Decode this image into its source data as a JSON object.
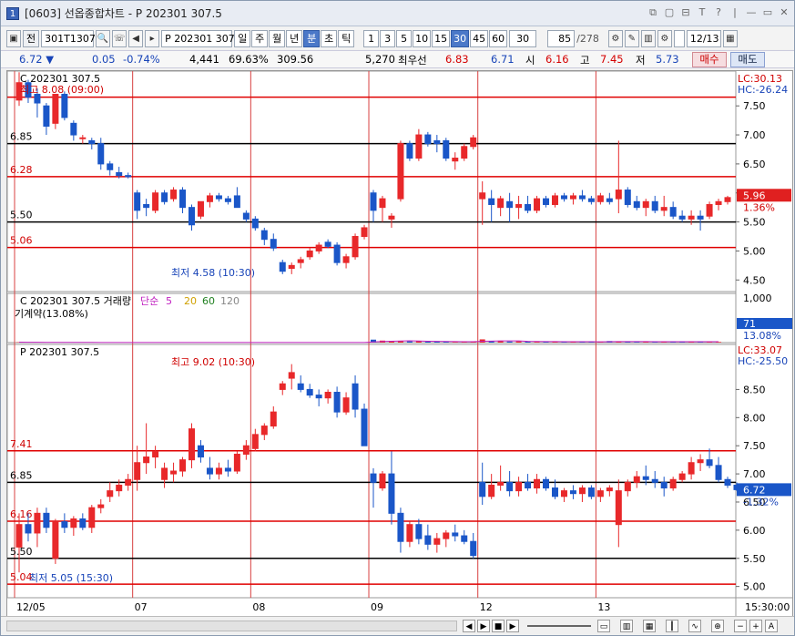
{
  "window": {
    "title": "[0603] 선옵종합차트 - P 202301 307.5",
    "icon_text": "1",
    "title_buttons": [
      "⧉",
      "▢",
      "⊟",
      "T",
      "?",
      "|",
      "—",
      "▭",
      "✕"
    ]
  },
  "toolbar": {
    "code1": "301T1307",
    "label_jeon": "전",
    "code2": "P 202301 307",
    "periods": [
      "일",
      "주",
      "월",
      "년",
      "분",
      "초",
      "틱"
    ],
    "selected_period": "분",
    "intervals": [
      "1",
      "3",
      "5",
      "10",
      "15",
      "30",
      "45",
      "60"
    ],
    "selected_interval": "30",
    "interval_select": "30",
    "count": "85",
    "count_total": "/278",
    "date": "12/13"
  },
  "infobar": {
    "price": "6.72",
    "change_arrow": "▼",
    "change": "0.05",
    "change_pct": "-0.74%",
    "volume": "4,441",
    "vol_pct": "69.63%",
    "v3": "309.56",
    "v4": "5,270",
    "best_label": "최우선",
    "best_ask": "6.83",
    "best_bid": "6.71",
    "open_label": "시",
    "open": "6.16",
    "high_label": "고",
    "high": "7.45",
    "low_label": "저",
    "low": "5.73",
    "buy": "매수",
    "sell": "매도"
  },
  "panel1": {
    "title": "C 202301 307.5",
    "high_note": "최고 8.08 (09:00)",
    "low_note": "최저 4.58 (10:30)",
    "lc": "LC:30.13",
    "hc": "HC:-26.24",
    "ticks": [
      "7.50",
      "7.00",
      "6.50",
      "6.00",
      "5.50",
      "5.00",
      "4.50"
    ],
    "price_tag": "5.96",
    "price_pct": "1.36%",
    "levels": [
      "6.85",
      "6.28",
      "5.50",
      "5.06"
    ]
  },
  "panel2": {
    "title": "C 202301 307.5 거래량",
    "ma_label": "단순",
    "mas": [
      "5",
      "20",
      "60",
      "120"
    ],
    "oi": "기계약(13.08%)",
    "ticks": [
      "1,000"
    ],
    "tag": "71",
    "tag_pct": "13.08%"
  },
  "panel3": {
    "title": "P 202301 307.5",
    "high_note": "최고 9.02 (10:30)",
    "low_note": "최저 5.05 (15:30)",
    "lc": "LC:33.07",
    "hc": "HC:-25.50",
    "ticks": [
      "8.50",
      "8.00",
      "7.50",
      "7.00",
      "6.50",
      "6.00",
      "5.50",
      "5.00"
    ],
    "price_tag": "6.72",
    "price_pct": "-1.32%",
    "levels": [
      "7.41",
      "6.85",
      "6.16",
      "5.50",
      "5.04"
    ]
  },
  "xaxis": {
    "labels": [
      "12/05",
      "07",
      "08",
      "09",
      "12",
      "13"
    ],
    "time": "15:30:00"
  },
  "colors": {
    "up": "#e8282a",
    "down": "#1a56c8",
    "level_red": "#e00000",
    "level_black": "#000000"
  },
  "chart_data": [
    {
      "type": "candlestick",
      "title": "C 202301 307.5",
      "ylim": [
        4.3,
        8.1
      ],
      "candles": [
        [
          7.6,
          8.08,
          7.5,
          7.9
        ],
        [
          7.9,
          7.95,
          7.55,
          7.65
        ],
        [
          7.7,
          7.8,
          7.3,
          7.55
        ],
        [
          7.5,
          7.55,
          7.0,
          7.15
        ],
        [
          7.2,
          7.7,
          7.1,
          7.7
        ],
        [
          7.7,
          7.75,
          7.25,
          7.3
        ],
        [
          7.2,
          7.25,
          6.9,
          7.0
        ],
        [
          6.95,
          7.0,
          6.85,
          6.95
        ],
        [
          6.9,
          6.95,
          6.75,
          6.85
        ],
        [
          6.85,
          6.95,
          6.4,
          6.5
        ],
        [
          6.5,
          6.55,
          6.3,
          6.4
        ],
        [
          6.35,
          6.45,
          6.25,
          6.3
        ],
        [
          6.3,
          6.35,
          6.25,
          6.28
        ],
        [
          6.0,
          6.05,
          5.55,
          5.7
        ],
        [
          5.8,
          5.9,
          5.6,
          5.75
        ],
        [
          5.7,
          6.05,
          5.65,
          6.0
        ],
        [
          6.0,
          6.05,
          5.8,
          5.85
        ],
        [
          5.9,
          6.1,
          5.85,
          6.05
        ],
        [
          6.05,
          6.1,
          5.65,
          5.75
        ],
        [
          5.75,
          5.8,
          5.35,
          5.45
        ],
        [
          5.6,
          5.85,
          5.55,
          5.85
        ],
        [
          5.85,
          6.0,
          5.75,
          5.95
        ],
        [
          5.95,
          6.0,
          5.85,
          5.9
        ],
        [
          5.9,
          5.95,
          5.8,
          5.85
        ],
        [
          5.95,
          6.1,
          5.8,
          5.75
        ],
        [
          5.65,
          5.7,
          5.5,
          5.55
        ],
        [
          5.55,
          5.6,
          5.35,
          5.4
        ],
        [
          5.35,
          5.4,
          5.1,
          5.2
        ],
        [
          5.2,
          5.3,
          5.0,
          5.05
        ],
        [
          4.8,
          4.85,
          4.6,
          4.65
        ],
        [
          4.7,
          4.8,
          4.6,
          4.75
        ],
        [
          4.8,
          4.9,
          4.7,
          4.85
        ],
        [
          4.9,
          5.05,
          4.85,
          5.0
        ],
        [
          5.0,
          5.15,
          4.95,
          5.1
        ],
        [
          5.15,
          5.2,
          5.05,
          5.08
        ],
        [
          5.1,
          5.15,
          4.75,
          4.8
        ],
        [
          4.8,
          4.95,
          4.7,
          4.9
        ],
        [
          4.9,
          5.3,
          4.85,
          5.25
        ],
        [
          5.25,
          5.45,
          5.2,
          5.4
        ],
        [
          6.0,
          6.05,
          5.5,
          5.7
        ],
        [
          5.75,
          5.95,
          5.5,
          5.9
        ],
        [
          5.55,
          5.65,
          5.4,
          5.6
        ],
        [
          5.9,
          6.9,
          5.85,
          6.85
        ],
        [
          6.85,
          6.9,
          6.55,
          6.6
        ],
        [
          6.6,
          7.1,
          6.55,
          7.0
        ],
        [
          7.0,
          7.05,
          6.8,
          6.85
        ],
        [
          6.9,
          7.0,
          6.7,
          6.85
        ],
        [
          6.9,
          6.95,
          6.55,
          6.6
        ],
        [
          6.55,
          6.7,
          6.4,
          6.6
        ],
        [
          6.6,
          6.85,
          6.55,
          6.8
        ],
        [
          6.8,
          7.0,
          6.75,
          6.95
        ],
        [
          5.9,
          6.2,
          5.45,
          6.0
        ],
        [
          5.9,
          6.05,
          5.5,
          5.8
        ],
        [
          5.75,
          5.95,
          5.6,
          5.9
        ],
        [
          5.85,
          6.0,
          5.5,
          5.75
        ],
        [
          5.75,
          5.95,
          5.55,
          5.8
        ],
        [
          5.8,
          5.95,
          5.65,
          5.7
        ],
        [
          5.7,
          5.95,
          5.65,
          5.9
        ],
        [
          5.9,
          5.95,
          5.75,
          5.8
        ],
        [
          5.8,
          6.0,
          5.75,
          5.95
        ],
        [
          5.95,
          6.0,
          5.85,
          5.9
        ],
        [
          5.9,
          6.0,
          5.8,
          5.95
        ],
        [
          5.95,
          6.05,
          5.85,
          5.9
        ],
        [
          5.9,
          5.95,
          5.8,
          5.85
        ],
        [
          5.85,
          6.0,
          5.8,
          5.95
        ],
        [
          5.9,
          6.0,
          5.8,
          5.85
        ],
        [
          5.9,
          6.9,
          5.65,
          6.05
        ],
        [
          6.05,
          6.1,
          5.75,
          5.8
        ],
        [
          5.85,
          5.95,
          5.7,
          5.75
        ],
        [
          5.75,
          5.9,
          5.6,
          5.85
        ],
        [
          5.85,
          5.95,
          5.65,
          5.7
        ],
        [
          5.7,
          5.95,
          5.6,
          5.75
        ],
        [
          5.75,
          5.85,
          5.55,
          5.6
        ],
        [
          5.6,
          5.7,
          5.5,
          5.55
        ],
        [
          5.55,
          5.7,
          5.45,
          5.6
        ],
        [
          5.6,
          5.7,
          5.35,
          5.55
        ],
        [
          5.6,
          5.85,
          5.55,
          5.8
        ],
        [
          5.8,
          5.9,
          5.7,
          5.85
        ],
        [
          5.85,
          5.95,
          5.8,
          5.92
        ]
      ]
    },
    {
      "type": "bar",
      "title": "C 202301 307.5 거래량",
      "values": [
        10,
        4,
        6,
        3,
        8,
        5,
        3,
        2,
        3,
        4,
        3,
        2,
        2,
        3,
        2,
        3,
        2,
        4,
        3,
        4,
        2,
        3,
        2,
        3,
        2,
        3,
        4,
        3,
        4,
        2,
        3,
        2,
        2,
        3,
        2,
        2,
        4,
        5,
        3,
        66,
        45,
        38,
        32,
        28,
        34,
        22,
        25,
        20,
        15,
        18,
        26,
        72,
        40,
        30,
        25,
        28,
        22,
        18,
        25,
        20,
        22,
        18,
        16,
        20,
        18,
        35,
        25,
        22,
        18,
        20,
        18,
        24,
        20,
        16,
        22,
        18,
        25,
        15
      ],
      "ylim": [
        0,
        1100
      ]
    },
    {
      "type": "candlestick",
      "title": "P 202301 307.5",
      "ylim": [
        4.8,
        9.3
      ],
      "candles": [
        [
          5.7,
          6.3,
          5.25,
          6.1
        ],
        [
          6.1,
          6.3,
          5.8,
          5.95
        ],
        [
          5.95,
          6.4,
          5.7,
          6.3
        ],
        [
          6.3,
          6.4,
          5.95,
          6.05
        ],
        [
          5.5,
          6.2,
          5.4,
          6.15
        ],
        [
          6.15,
          6.3,
          5.95,
          6.05
        ],
        [
          6.05,
          6.25,
          5.9,
          6.2
        ],
        [
          6.2,
          6.3,
          6.0,
          6.05
        ],
        [
          6.05,
          6.45,
          5.95,
          6.4
        ],
        [
          6.4,
          6.55,
          6.3,
          6.45
        ],
        [
          6.6,
          6.85,
          6.5,
          6.7
        ],
        [
          6.7,
          6.9,
          6.6,
          6.8
        ],
        [
          6.8,
          7.0,
          6.7,
          6.9
        ],
        [
          6.9,
          7.5,
          6.7,
          7.2
        ],
        [
          7.2,
          7.9,
          7.0,
          7.3
        ],
        [
          7.3,
          7.5,
          7.1,
          7.4
        ],
        [
          6.9,
          7.2,
          6.75,
          7.1
        ],
        [
          7.0,
          7.2,
          6.85,
          7.05
        ],
        [
          7.05,
          7.3,
          6.95,
          7.25
        ],
        [
          7.25,
          7.9,
          7.1,
          7.8
        ],
        [
          7.5,
          7.6,
          7.2,
          7.3
        ],
        [
          7.1,
          7.3,
          6.9,
          7.0
        ],
        [
          7.0,
          7.2,
          6.9,
          7.1
        ],
        [
          7.1,
          7.25,
          6.95,
          7.05
        ],
        [
          7.05,
          7.4,
          7.0,
          7.35
        ],
        [
          7.35,
          7.6,
          7.25,
          7.5
        ],
        [
          7.45,
          7.8,
          7.4,
          7.7
        ],
        [
          7.7,
          7.9,
          7.6,
          7.85
        ],
        [
          7.85,
          8.2,
          7.8,
          8.1
        ],
        [
          8.5,
          8.65,
          8.4,
          8.6
        ],
        [
          8.7,
          8.95,
          8.5,
          8.8
        ],
        [
          8.6,
          8.75,
          8.45,
          8.5
        ],
        [
          8.5,
          8.6,
          8.35,
          8.4
        ],
        [
          8.4,
          8.5,
          8.2,
          8.35
        ],
        [
          8.35,
          8.5,
          8.25,
          8.45
        ],
        [
          8.45,
          8.55,
          8.0,
          8.1
        ],
        [
          8.1,
          8.45,
          8.05,
          8.35
        ],
        [
          8.6,
          8.75,
          8.0,
          8.15
        ],
        [
          8.15,
          8.25,
          7.9,
          7.5
        ],
        [
          7.0,
          7.1,
          6.4,
          6.85
        ],
        [
          6.75,
          7.05,
          6.7,
          7.0
        ],
        [
          7.0,
          7.4,
          6.1,
          6.3
        ],
        [
          6.3,
          6.4,
          5.6,
          5.8
        ],
        [
          5.8,
          6.15,
          5.7,
          6.1
        ],
        [
          6.1,
          6.2,
          5.75,
          5.85
        ],
        [
          5.9,
          6.1,
          5.65,
          5.75
        ],
        [
          5.75,
          5.95,
          5.6,
          5.85
        ],
        [
          5.85,
          6.0,
          5.7,
          5.95
        ],
        [
          5.95,
          6.1,
          5.8,
          5.9
        ],
        [
          5.9,
          6.0,
          5.75,
          5.8
        ],
        [
          5.8,
          5.95,
          5.5,
          5.55
        ],
        [
          6.85,
          7.2,
          6.45,
          6.6
        ],
        [
          6.6,
          7.0,
          6.55,
          6.8
        ],
        [
          6.8,
          7.15,
          6.7,
          6.85
        ],
        [
          6.85,
          7.05,
          6.6,
          6.7
        ],
        [
          6.7,
          6.95,
          6.6,
          6.85
        ],
        [
          6.85,
          7.0,
          6.7,
          6.75
        ],
        [
          6.75,
          7.0,
          6.65,
          6.9
        ],
        [
          6.9,
          6.95,
          6.7,
          6.75
        ],
        [
          6.75,
          6.9,
          6.55,
          6.6
        ],
        [
          6.6,
          6.75,
          6.5,
          6.7
        ],
        [
          6.7,
          6.8,
          6.55,
          6.65
        ],
        [
          6.65,
          6.8,
          6.5,
          6.75
        ],
        [
          6.75,
          6.8,
          6.55,
          6.6
        ],
        [
          6.6,
          6.75,
          6.5,
          6.7
        ],
        [
          6.7,
          6.8,
          6.6,
          6.75
        ],
        [
          6.1,
          6.9,
          5.7,
          6.7
        ],
        [
          6.7,
          6.9,
          6.6,
          6.85
        ],
        [
          6.85,
          7.05,
          6.75,
          6.95
        ],
        [
          6.95,
          7.15,
          6.8,
          6.9
        ],
        [
          6.9,
          7.05,
          6.75,
          6.85
        ],
        [
          6.85,
          6.95,
          6.6,
          6.75
        ],
        [
          6.75,
          6.95,
          6.7,
          6.9
        ],
        [
          6.9,
          7.05,
          6.85,
          7.0
        ],
        [
          7.0,
          7.3,
          6.9,
          7.2
        ],
        [
          7.2,
          7.35,
          7.05,
          7.25
        ],
        [
          7.25,
          7.45,
          7.1,
          7.15
        ],
        [
          7.15,
          7.3,
          6.85,
          6.9
        ],
        [
          6.9,
          6.95,
          6.75,
          6.8
        ],
        [
          6.8,
          6.85,
          6.7,
          6.72
        ]
      ]
    }
  ]
}
